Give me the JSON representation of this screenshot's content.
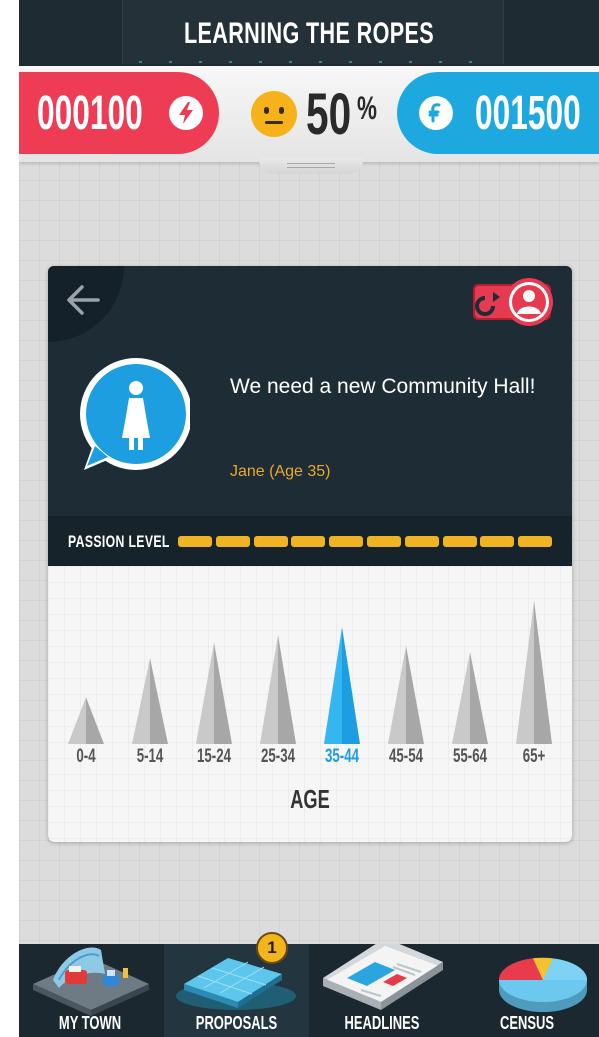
{
  "header": {
    "title": "LEARNING THE ROPES"
  },
  "stats": {
    "energy": {
      "value": "000100",
      "icon": "lightning-icon",
      "color": "#ee3c55"
    },
    "happiness": {
      "value": "50",
      "unit": "%",
      "icon": "neutral-face-icon",
      "color": "#f5b21b"
    },
    "money": {
      "value": "001500",
      "icon": "currency-icon",
      "color": "#1da8df"
    }
  },
  "proposal": {
    "quote": "We need a new Community Hall!",
    "speaker": "Jane (Age 35)",
    "back_icon": "back-arrow-icon",
    "swap_icon": "swap-citizen-icon",
    "avatar_icon": "person-icon",
    "passion": {
      "label": "PASSION LEVEL",
      "level": 10,
      "max": 10,
      "color": "#f0b323"
    }
  },
  "chart_data": {
    "type": "bar",
    "xlabel": "AGE",
    "categories": [
      "0-4",
      "5-14",
      "15-24",
      "25-34",
      "35-44",
      "45-54",
      "55-64",
      "65+"
    ],
    "values": [
      3,
      5.5,
      6.5,
      7,
      7.5,
      6.3,
      5.9,
      9.2
    ],
    "highlighted": "35-44",
    "highlight_color": "#1d9ee0"
  },
  "nav": {
    "items": [
      {
        "label": "MY TOWN",
        "icon": "town-icon",
        "active": false
      },
      {
        "label": "PROPOSALS",
        "icon": "proposals-icon",
        "active": true,
        "badge": "1"
      },
      {
        "label": "HEADLINES",
        "icon": "newspaper-icon",
        "active": false
      },
      {
        "label": "CENSUS",
        "icon": "pie-chart-icon",
        "active": false
      }
    ]
  }
}
